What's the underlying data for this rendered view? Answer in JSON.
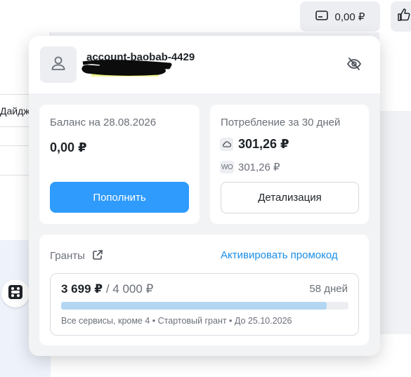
{
  "background": {
    "digest_text": "Дайдж",
    "balance_chip": "0,00 ₽"
  },
  "popup": {
    "account_name": "account-baobab-4429",
    "balance_card": {
      "label": "Баланс на 28.08.2026",
      "value": "0,00 ₽",
      "topup_button": "Пополнить"
    },
    "usage_card": {
      "label": "Потребление за 30 дней",
      "cloud_value": "301,26 ₽",
      "wo_badge": "WO",
      "wo_value": "301,26 ₽",
      "details_button": "Детализация"
    },
    "grants_card": {
      "label": "Гранты",
      "activate_promo": "Активировать промокод",
      "grant": {
        "used": "3 699 ₽",
        "separator": "/",
        "total": "4 000 ₽",
        "days_left": "58 дней",
        "progress": 0.925,
        "description": "Все сервисы, кроме 4 • Стартовый грант • До 25.10.2026"
      }
    }
  },
  "icons": {
    "card": "credit-card-icon",
    "thumb": "thumb-up-icon",
    "grid": "services-grid-icon",
    "user": "user-icon",
    "eye": "eye-off-icon",
    "cloud": "cloud-icon",
    "external": "external-link-icon"
  },
  "colors": {
    "accent": "#2e9bfd",
    "link": "#1b8ee8",
    "progress_fill": "#b3d6f2"
  }
}
